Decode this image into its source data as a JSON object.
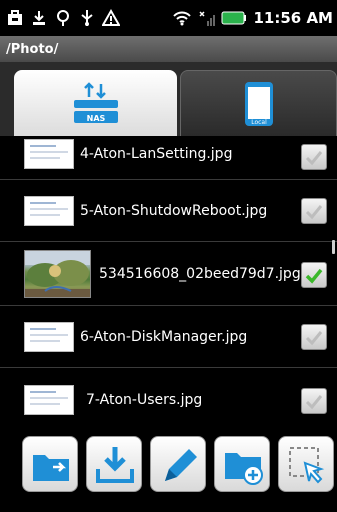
{
  "status_bar": {
    "time": "11:56 AM",
    "icons": [
      "bag-icon",
      "download-icon",
      "location-icon",
      "usb-icon",
      "warning-icon",
      "wifi-icon",
      "signal-icon",
      "battery-icon"
    ]
  },
  "path": "/Photo/",
  "tabs": [
    {
      "label": "NAS",
      "icon": "nas-icon",
      "selected": true
    },
    {
      "label": "Local",
      "icon": "phone-icon",
      "selected": false
    }
  ],
  "files": [
    {
      "name": "4-Aton-LanSetting.jpg",
      "checked": false,
      "thumb": "screenshot"
    },
    {
      "name": "5-Aton-ShutdowReboot.jpg",
      "checked": false,
      "thumb": "screenshot"
    },
    {
      "name": "534516608_02beed79d7.jpg",
      "checked": true,
      "thumb": "photo"
    },
    {
      "name": "6-Aton-DiskManager.jpg",
      "checked": false,
      "thumb": "screenshot"
    },
    {
      "name": "7-Aton-Users.jpg",
      "checked": false,
      "thumb": "screenshot"
    }
  ],
  "toolbar": {
    "buttons": [
      "folder-share-icon",
      "download-icon",
      "rename-pencil-icon",
      "new-folder-icon",
      "select-icon"
    ]
  },
  "colors": {
    "accent_blue": "#1f8fd6",
    "check_green": "#3bb82a",
    "background": "#000000"
  }
}
